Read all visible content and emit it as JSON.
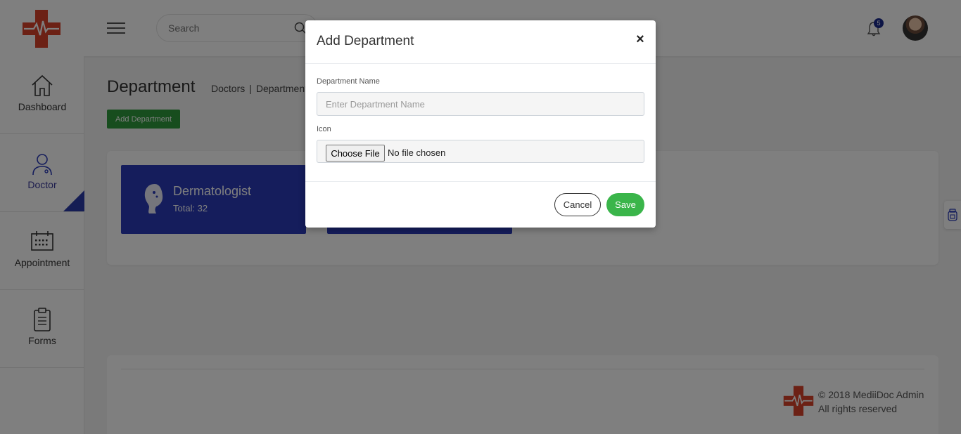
{
  "header": {
    "search_placeholder": "Search",
    "notification_count": "5"
  },
  "sidebar": {
    "items": [
      {
        "label": "Dashboard",
        "icon": "home-icon"
      },
      {
        "label": "Doctor",
        "icon": "doctor-icon"
      },
      {
        "label": "Appointment",
        "icon": "calendar-icon"
      },
      {
        "label": "Forms",
        "icon": "clipboard-icon"
      }
    ]
  },
  "main": {
    "title": "Department",
    "breadcrumb": [
      "Doctors",
      "|",
      "Department"
    ],
    "add_button": "Add Department",
    "cards": [
      {
        "name": "Dermatologist",
        "total": "Total: 32"
      }
    ]
  },
  "footer": {
    "line1": "© 2018 MediiDoc Admin",
    "line2": "All rights reserved"
  },
  "modal": {
    "title": "Add Department",
    "close": "×",
    "name_label": "Department Name",
    "name_placeholder": "Enter Department Name",
    "icon_label": "Icon",
    "file_button": "Choose File",
    "file_status": "No file chosen",
    "cancel": "Cancel",
    "save": "Save"
  },
  "colors": {
    "brand_red": "#d8432a",
    "card_blue": "#2a3ab8",
    "save_green": "#3ab54a",
    "add_green": "#2e9a3c"
  }
}
